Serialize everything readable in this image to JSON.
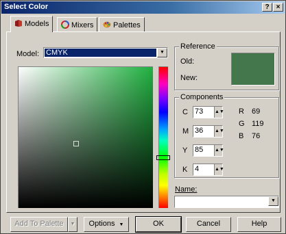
{
  "window": {
    "title": "Select Color",
    "help_button": "?",
    "close_button": "×"
  },
  "tabs": [
    {
      "label": "Models",
      "icon": "models-icon",
      "active": true
    },
    {
      "label": "Mixers",
      "icon": "mixers-icon",
      "active": false
    },
    {
      "label": "Palettes",
      "icon": "palettes-icon",
      "active": false
    }
  ],
  "model": {
    "label": "Model:",
    "value": "CMYK"
  },
  "reference": {
    "title": "Reference",
    "old_label": "Old:",
    "new_label": "New:",
    "new_color": "#45774c"
  },
  "components": {
    "title": "Components",
    "cmyk": [
      {
        "label": "C",
        "value": "73"
      },
      {
        "label": "M",
        "value": "36"
      },
      {
        "label": "Y",
        "value": "85"
      },
      {
        "label": "K",
        "value": "4"
      }
    ],
    "rgb": [
      {
        "label": "R",
        "value": "69"
      },
      {
        "label": "G",
        "value": "119"
      },
      {
        "label": "B",
        "value": "76"
      }
    ]
  },
  "name": {
    "label": "Name:",
    "value": ""
  },
  "buttons": {
    "add_to_palette": "Add To Palette",
    "options": "Options",
    "ok": "OK",
    "cancel": "Cancel",
    "help": "Help"
  }
}
